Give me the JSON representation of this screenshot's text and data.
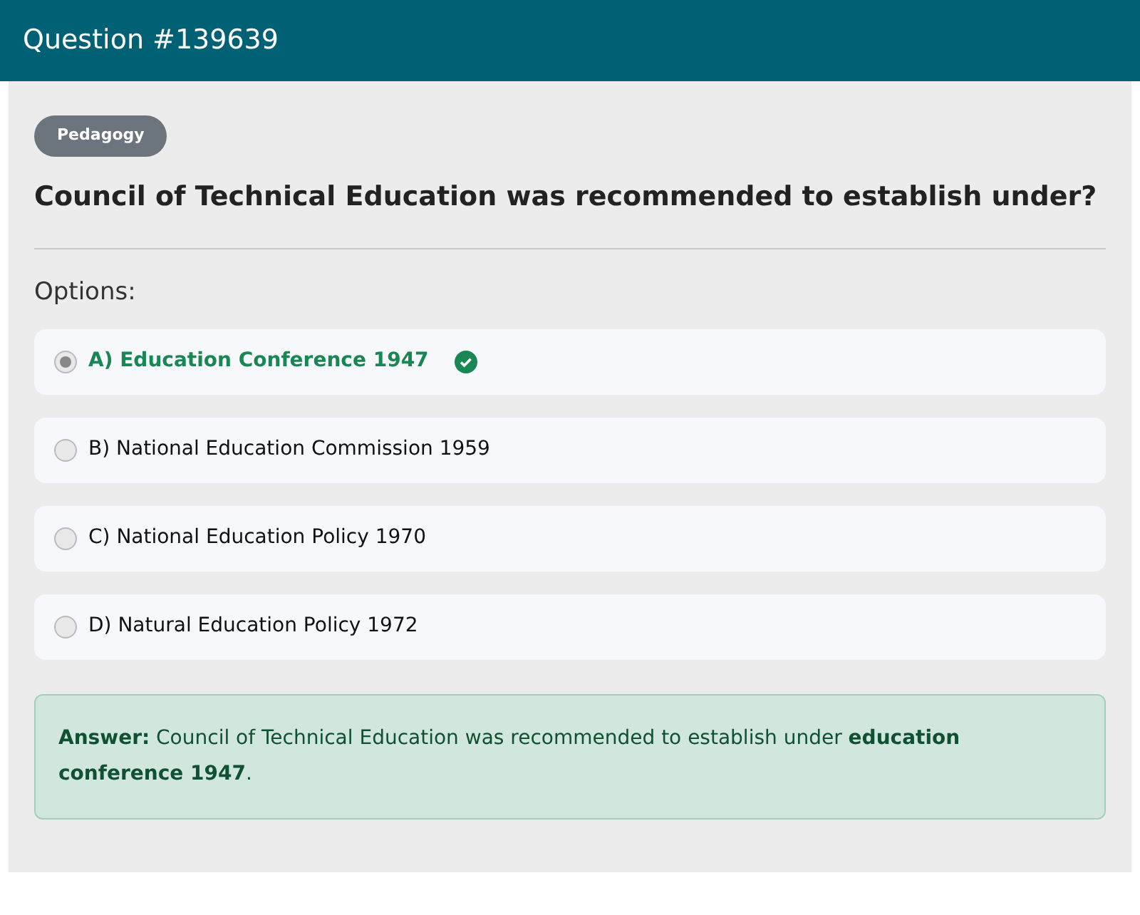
{
  "header": {
    "title": "Question #139639"
  },
  "category": "Pedagogy",
  "question": "Council of Technical Education was recommended to establish under?",
  "options_label": "Options:",
  "options": [
    {
      "label": "A) Education Conference 1947",
      "selected": true,
      "correct": true
    },
    {
      "label": "B) National Education Commission 1959",
      "selected": false,
      "correct": false
    },
    {
      "label": "C) National Education Policy 1970",
      "selected": false,
      "correct": false
    },
    {
      "label": "D) Natural Education Policy 1972",
      "selected": false,
      "correct": false
    }
  ],
  "answer": "**Answer:** Council of Technical Education was recommended to establish under **education conference 1947**."
}
